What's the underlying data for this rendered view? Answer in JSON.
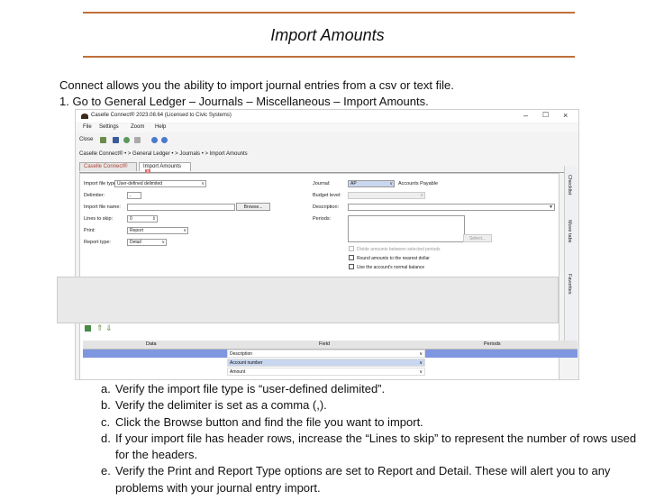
{
  "doc": {
    "title": "Import Amounts",
    "intro": "Connect allows you the ability to import journal entries from a csv or text file.",
    "step1": "1.  Go to General Ledger – Journals – Miscellaneous – Import Amounts.",
    "steps": [
      {
        "letter": "a.",
        "text": "Verify the import file type is “user-defined delimited”."
      },
      {
        "letter": "b.",
        "text": "Verify the delimiter is set as a comma (,)."
      },
      {
        "letter": "c.",
        "text": "Click the Browse button and find the file you want to import."
      },
      {
        "letter": "d.",
        "text": "If your import file has header rows, increase the “Lines to skip” to represent the number of rows used for the headers."
      },
      {
        "letter": "e.",
        "text": "Verify the Print and Report Type options are set to Report and Detail.  These will alert you to any problems with your journal entry import."
      }
    ]
  },
  "app": {
    "window_title": "Caselle Connect® 2023.08.64    (Licensed to Civic Systems)",
    "menu": [
      "File",
      "Settings",
      "Zoom",
      "Help"
    ],
    "toolbar_close": "Close",
    "breadcrumb": "Caselle Connect®  •  >  General Ledger  •  >  Journals  •  >  Import Amounts",
    "tabs": [
      "Caselle Connect®",
      "Import Amounts"
    ],
    "form": {
      "import_type_label": "Import file type:",
      "import_type_value": "User-defined delimited",
      "delimiter_label": "Delimiter:",
      "delimiter_value": ",",
      "file_name_label": "Import file name:",
      "browse": "Browse...",
      "lines_label": "Lines to skip:",
      "lines_value": "0",
      "print_label": "Print:",
      "print_value": "Report",
      "report_label": "Report type:",
      "report_value": "Detail",
      "journal_label": "Journal:",
      "journal_code": "AP",
      "journal_name": "Accounts Payable",
      "budget_label": "Budget level:",
      "description_label": "Description:",
      "periods_label": "Periods:",
      "select_btn": "Select...",
      "chk1": "Divide amounts between selected periods",
      "chk2": "Round amounts to the nearest dollar",
      "chk3": "Use the account's normal balance"
    },
    "table": {
      "headers": [
        "Data",
        "Field",
        "Periods"
      ],
      "fields": [
        "Description",
        "Account number",
        "Amount"
      ]
    },
    "sidebar": [
      "Checklist",
      "Move tabs",
      "Favorites"
    ],
    "colors": {
      "accent_rule": "#c0703a",
      "row_selected": "#7f96e0"
    }
  }
}
